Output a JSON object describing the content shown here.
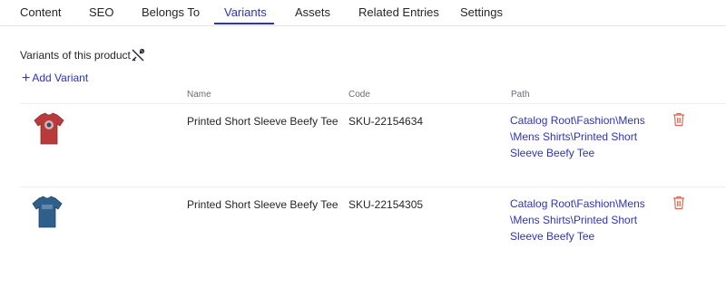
{
  "tabs": [
    {
      "label": "Content"
    },
    {
      "label": "SEO"
    },
    {
      "label": "Belongs To"
    },
    {
      "label": "Variants"
    },
    {
      "label": "Assets"
    },
    {
      "label": "Related Entries"
    },
    {
      "label": "Settings"
    }
  ],
  "active_tab": "Variants",
  "section": {
    "title": "Variants of this product",
    "tools_icon": "tools-icon",
    "add_variant_label": "Add Variant"
  },
  "table": {
    "headers": {
      "name": "Name",
      "code": "Code",
      "path": "Path"
    },
    "rows": [
      {
        "thumbnail": "red-tshirt",
        "thumbnail_color": "#b83a3a",
        "name": "Printed Short Sleeve Beefy Tee",
        "code": "SKU-22154634",
        "path": "Catalog Root\\Fashion\\Mens\\Mens Shirts\\Printed Short Sleeve Beefy Tee",
        "delete_icon": "trash-icon"
      },
      {
        "thumbnail": "blue-tshirt",
        "thumbnail_color": "#2f5f8a",
        "name": "Printed Short Sleeve Beefy Tee",
        "code": "SKU-22154305",
        "path": "Catalog Root\\Fashion\\Mens\\Mens Shirts\\Printed Short Sleeve Beefy Tee",
        "delete_icon": "trash-icon"
      }
    ]
  },
  "colors": {
    "accent": "#2f33b8",
    "delete": "#e0674f"
  }
}
